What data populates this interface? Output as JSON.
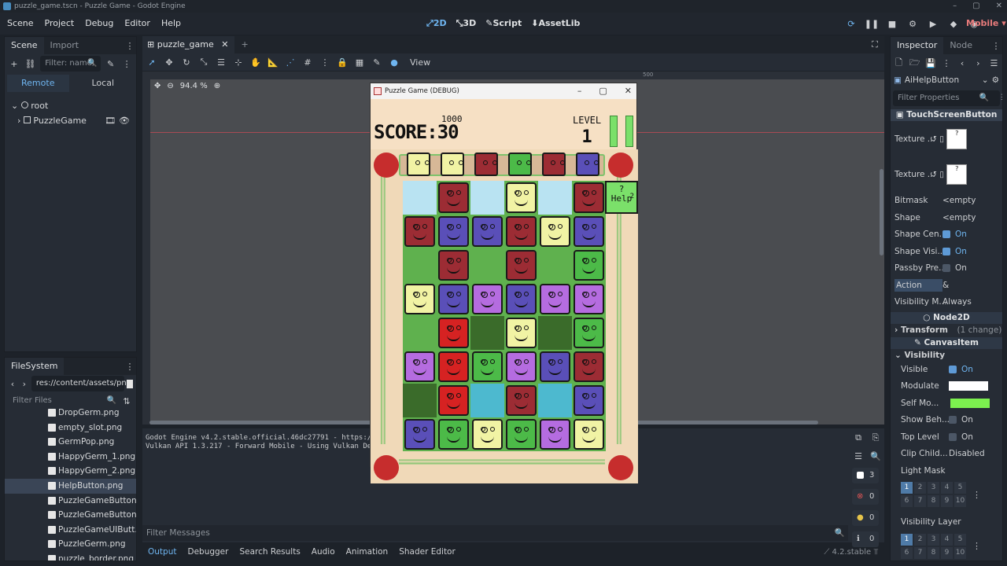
{
  "window": {
    "title": "puzzle_game.tscn - Puzzle Game - Godot Engine"
  },
  "menu": [
    "Scene",
    "Project",
    "Debug",
    "Editor",
    "Help"
  ],
  "workspaces": [
    {
      "label": "2D",
      "icon": "2d-icon"
    },
    {
      "label": "3D",
      "icon": "3d-icon"
    },
    {
      "label": "Script",
      "icon": "script-icon"
    },
    {
      "label": "AssetLib",
      "icon": "assetlib-icon"
    }
  ],
  "renderer": "Mobile",
  "scene_dock": {
    "tabs": [
      "Scene",
      "Import"
    ],
    "filter_placeholder": "Filter: name,",
    "remote": "Remote",
    "local": "Local",
    "tree": [
      {
        "label": "root"
      },
      {
        "label": "PuzzleGame"
      }
    ]
  },
  "filesystem": {
    "tab": "FileSystem",
    "path": "res://content/assets/png",
    "filter_placeholder": "Filter Files",
    "items": [
      "DropGerm.png",
      "empty_slot.png",
      "GermPop.png",
      "HappyGerm_1.png",
      "HappyGerm_2.png",
      "HelpButton.png",
      "PuzzleGameButton...",
      "PuzzleGameButton...",
      "PuzzleGameUIButt...",
      "PuzzleGerm.png",
      "puzzle_border.png"
    ],
    "selected": 5
  },
  "editor": {
    "scene_tab": "puzzle_game",
    "zoom": "94.4 %",
    "view_menu": "View",
    "ruler_mark": "500"
  },
  "game": {
    "title": "Puzzle Game (DEBUG)",
    "score_label": "SCORE:30",
    "target": "1000",
    "level_label": "LEVEL",
    "level_value": "1",
    "help_label": "Help",
    "help_count": "2",
    "top_row": [
      "yellow",
      "yellow",
      "red",
      "green",
      "red",
      "purple"
    ],
    "grid": [
      [
        "sky",
        "red",
        "sky",
        "yellow",
        "sky",
        "red"
      ],
      [
        "red",
        "purple",
        "purple",
        "red",
        "yellow",
        "purple"
      ],
      [
        "tree",
        "red",
        "tree",
        "red",
        "tree",
        "green"
      ],
      [
        "yellow",
        "purple",
        "violet",
        "purple",
        "violet",
        "violet"
      ],
      [
        "tree",
        "bright",
        "trunk",
        "yellow",
        "trunk",
        "green"
      ],
      [
        "violet",
        "bright",
        "green",
        "violet",
        "purple",
        "red"
      ],
      [
        "trunk",
        "bright",
        "water",
        "red",
        "water",
        "purple"
      ],
      [
        "purple",
        "green",
        "yellow",
        "green",
        "violet",
        "yellow"
      ]
    ],
    "colors": {
      "red": "#9c2c34",
      "bright": "#d62222",
      "yellow": "#f1f3a4",
      "green": "#4cba48",
      "purple": "#5a4fb8",
      "violet": "#b56ce0",
      "sky": "#b9e3f2",
      "tree": "#5fb14e",
      "trunk": "#3a6b2a",
      "water": "#4db9cf"
    }
  },
  "output": {
    "lines": [
      "Godot Engine v4.2.stable.official.46dc27791 - https://g",
      "Vulkan API 1.3.217 - Forward Mobile - Using Vulkan Devi"
    ],
    "filter_placeholder": "Filter Messages",
    "counts": [
      "3",
      "0",
      "0",
      "0"
    ]
  },
  "bottom_tabs": [
    "Output",
    "Debugger",
    "Search Results",
    "Audio",
    "Animation",
    "Shader Editor"
  ],
  "version": "4.2.stable",
  "inspector": {
    "tabs": [
      "Inspector",
      "Node"
    ],
    "node": "AiHelpButton",
    "filter_placeholder": "Filter Properties",
    "class_header": "TouchScreenButton",
    "props": [
      {
        "label": "Texture ...",
        "value": ""
      },
      {
        "label": "Texture ...",
        "value": ""
      },
      {
        "label": "Bitmask",
        "value": "<empty"
      },
      {
        "label": "Shape",
        "value": "<empty"
      },
      {
        "label": "Shape Cen...",
        "value": "On",
        "check": true
      },
      {
        "label": "Shape Visi...",
        "value": "On",
        "check": true
      },
      {
        "label": "Passby Pre...",
        "value": "On",
        "check": false
      },
      {
        "label": "Action",
        "value": "&"
      },
      {
        "label": "Visibility M...",
        "value": "Always"
      }
    ],
    "node2d": "Node2D",
    "transform": "Transform",
    "transform_note": "(1 change)",
    "canvas_item": "CanvasItem",
    "visibility": "Visibility",
    "vis_props": [
      {
        "label": "Visible",
        "value": "On",
        "check": true
      },
      {
        "label": "Modulate",
        "value": ""
      },
      {
        "label": "Self Mo...",
        "value": ""
      },
      {
        "label": "Show Beh...",
        "value": "On",
        "check": false
      },
      {
        "label": "Top Level",
        "value": "On",
        "check": false
      },
      {
        "label": "Clip Child...",
        "value": "Disabled"
      }
    ],
    "light_mask": "Light Mask",
    "visibility_layer": "Visibility Layer",
    "layers": [
      "1",
      "2",
      "3",
      "4",
      "5",
      "6",
      "7",
      "8",
      "9",
      "10"
    ]
  }
}
